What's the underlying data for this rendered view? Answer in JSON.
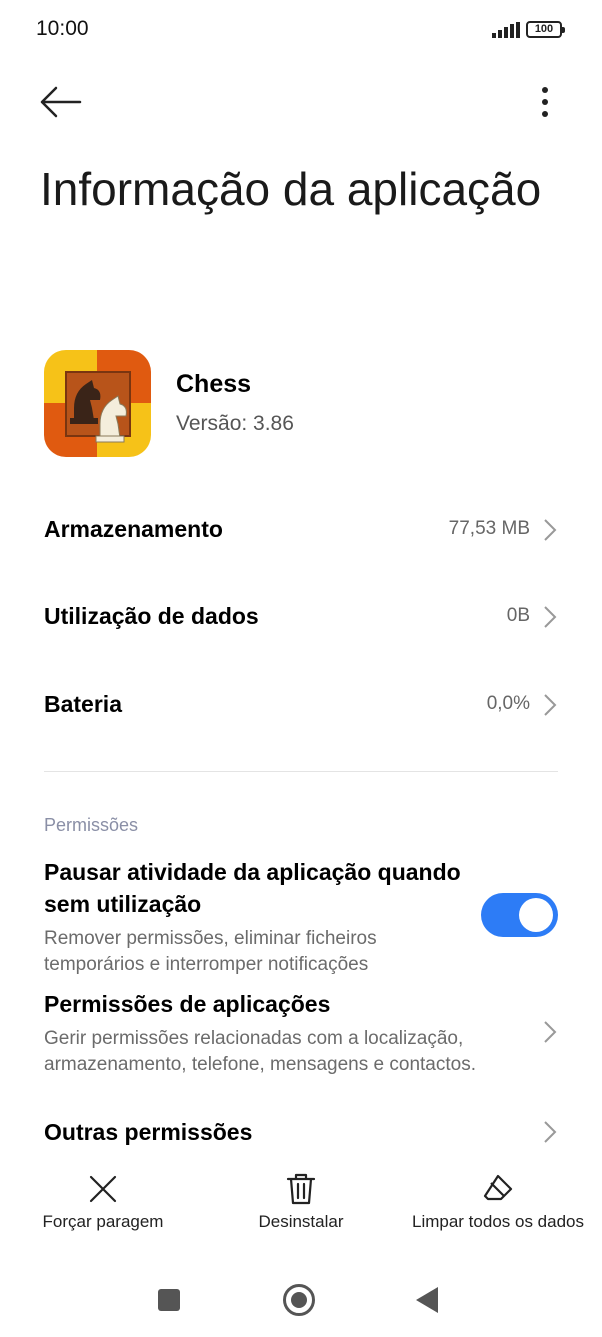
{
  "status_bar": {
    "time": "10:00",
    "battery": "100"
  },
  "header": {
    "back_icon": "arrow-left-icon",
    "more_icon": "more-vertical-icon"
  },
  "page_title": "Informação da aplicação",
  "app": {
    "name": "Chess",
    "version": "Versão: 3.86",
    "icon": "chess-knights-icon"
  },
  "rows": [
    {
      "label": "Armazenamento",
      "value": "77,53 MB"
    },
    {
      "label": "Utilização de dados",
      "value": "0B"
    },
    {
      "label": "Bateria",
      "value": "0,0%"
    }
  ],
  "permissions": {
    "section_label": "Permissões",
    "pause": {
      "title": "Pausar atividade da aplicação quando sem utilização",
      "description": "Remover permissões, eliminar ficheiros temporários e interromper notificações",
      "enabled": true
    },
    "app_permissions": {
      "title": "Permissões de aplicações",
      "description": "Gerir permissões relacionadas com a localização, armazenamento, telefone, mensagens e contactos."
    },
    "other": {
      "title": "Outras permissões"
    }
  },
  "actions": [
    {
      "label": "Forçar paragem",
      "icon": "close-icon"
    },
    {
      "label": "Desinstalar",
      "icon": "trash-icon"
    },
    {
      "label": "Limpar todos os dados",
      "icon": "eraser-icon"
    }
  ],
  "colors": {
    "accent": "#2d7cf6",
    "section": "#8a8fa6"
  }
}
